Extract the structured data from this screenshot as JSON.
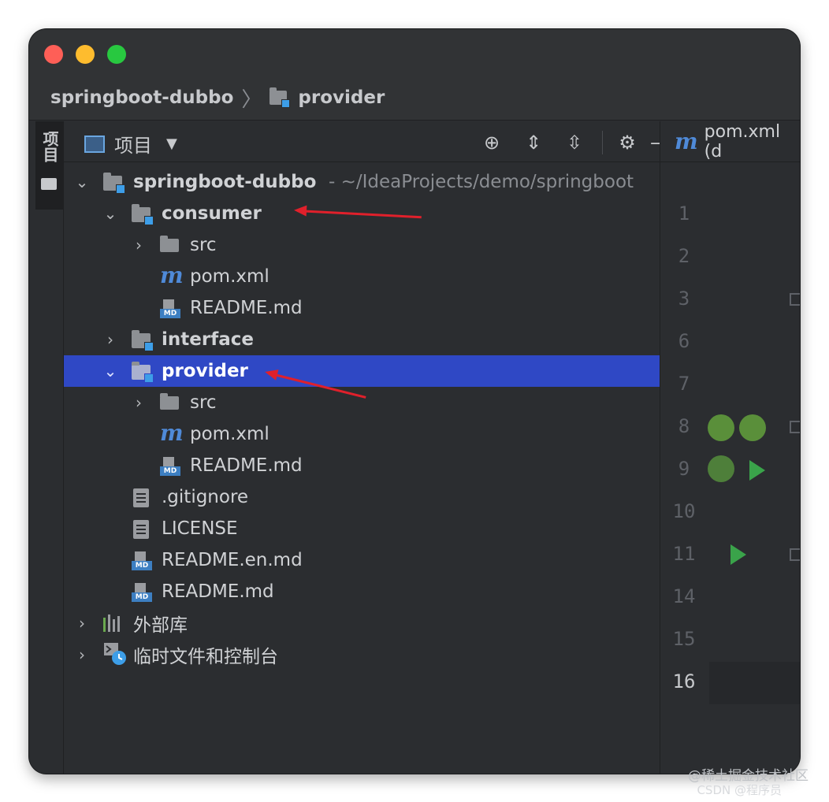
{
  "breadcrumb": {
    "root": "springboot-dubbo",
    "current": "provider"
  },
  "left_tool": {
    "label": "项目"
  },
  "project_panel": {
    "title": "项目",
    "toolbar_icons": [
      "locate-icon",
      "expand-all-icon",
      "collapse-all-icon",
      "gear-icon",
      "minimize-icon"
    ]
  },
  "tree": [
    {
      "label": "springboot-dubbo",
      "hint": "~/IdeaProjects/demo/springboot",
      "icon": "module-folder-icon",
      "expanded": true
    },
    {
      "label": "consumer",
      "icon": "module-folder-icon",
      "expanded": true
    },
    {
      "label": "src",
      "icon": "folder-icon",
      "expanded": false
    },
    {
      "label": "pom.xml",
      "icon": "maven-icon"
    },
    {
      "label": "README.md",
      "icon": "markdown-icon"
    },
    {
      "label": "interface",
      "icon": "module-folder-icon",
      "expanded": false
    },
    {
      "label": "provider",
      "icon": "module-folder-icon",
      "expanded": true,
      "selected": true
    },
    {
      "label": "src",
      "icon": "folder-icon",
      "expanded": false
    },
    {
      "label": "pom.xml",
      "icon": "maven-icon"
    },
    {
      "label": "README.md",
      "icon": "markdown-icon"
    },
    {
      "label": ".gitignore",
      "icon": "gitignore-icon"
    },
    {
      "label": "LICENSE",
      "icon": "text-file-icon"
    },
    {
      "label": "README.en.md",
      "icon": "markdown-icon"
    },
    {
      "label": "README.md",
      "icon": "markdown-icon"
    },
    {
      "label": "外部库",
      "icon": "library-icon",
      "expanded": false
    },
    {
      "label": "临时文件和控制台",
      "icon": "scratch-icon",
      "expanded": false
    }
  ],
  "editor": {
    "tab_label": "pom.xml (d",
    "line_numbers": [
      "1",
      "2",
      "3",
      "6",
      "7",
      "8",
      "9",
      "10",
      "11",
      "14",
      "15",
      "16"
    ],
    "current_line": "16"
  },
  "watermark": {
    "line1": "@稀土掘金技术社区",
    "line2": "CSDN @程序员"
  },
  "colors": {
    "selection": "#2f48c5",
    "annotation_arrow": "#e0202b"
  }
}
